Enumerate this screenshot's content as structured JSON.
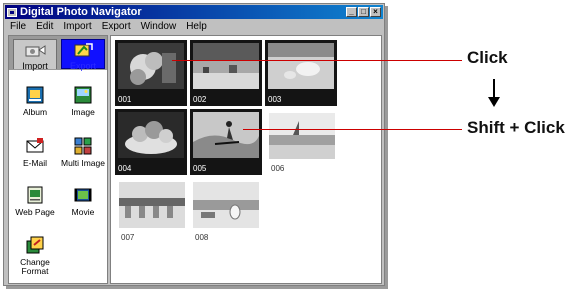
{
  "window": {
    "title": "Digital Photo Navigator",
    "buttons": [
      "_",
      "□",
      "×"
    ]
  },
  "menu": [
    "File",
    "Edit",
    "Import",
    "Export",
    "Window",
    "Help"
  ],
  "sidebar": {
    "tabs": [
      {
        "label": "Import",
        "icon": "camera-import-icon"
      },
      {
        "label": "Export",
        "icon": "export-icon"
      }
    ],
    "tools": [
      {
        "label": "Album",
        "icon": "album-icon"
      },
      {
        "label": "Image",
        "icon": "image-icon"
      },
      {
        "label": "E-Mail",
        "icon": "email-icon"
      },
      {
        "label": "Multi Image",
        "icon": "multi-image-icon"
      },
      {
        "label": "Web Page",
        "icon": "web-page-icon"
      },
      {
        "label": "Movie",
        "icon": "movie-icon"
      },
      {
        "label": "Change Format",
        "icon": "change-format-icon"
      }
    ]
  },
  "thumbnails": [
    {
      "label": "001",
      "selected": true
    },
    {
      "label": "002",
      "selected": true
    },
    {
      "label": "003",
      "selected": true
    },
    {
      "label": "004",
      "selected": true
    },
    {
      "label": "005",
      "selected": true
    },
    {
      "label": "006",
      "selected": false
    },
    {
      "label": "007",
      "selected": false
    },
    {
      "label": "008",
      "selected": false
    }
  ],
  "callouts": {
    "click": "Click",
    "shift_click": "Shift + Click"
  },
  "colors": {
    "title_bar": "#000080",
    "selection": "#141414",
    "callout_line": "#cc0000",
    "export_tab": "#1010ff"
  }
}
